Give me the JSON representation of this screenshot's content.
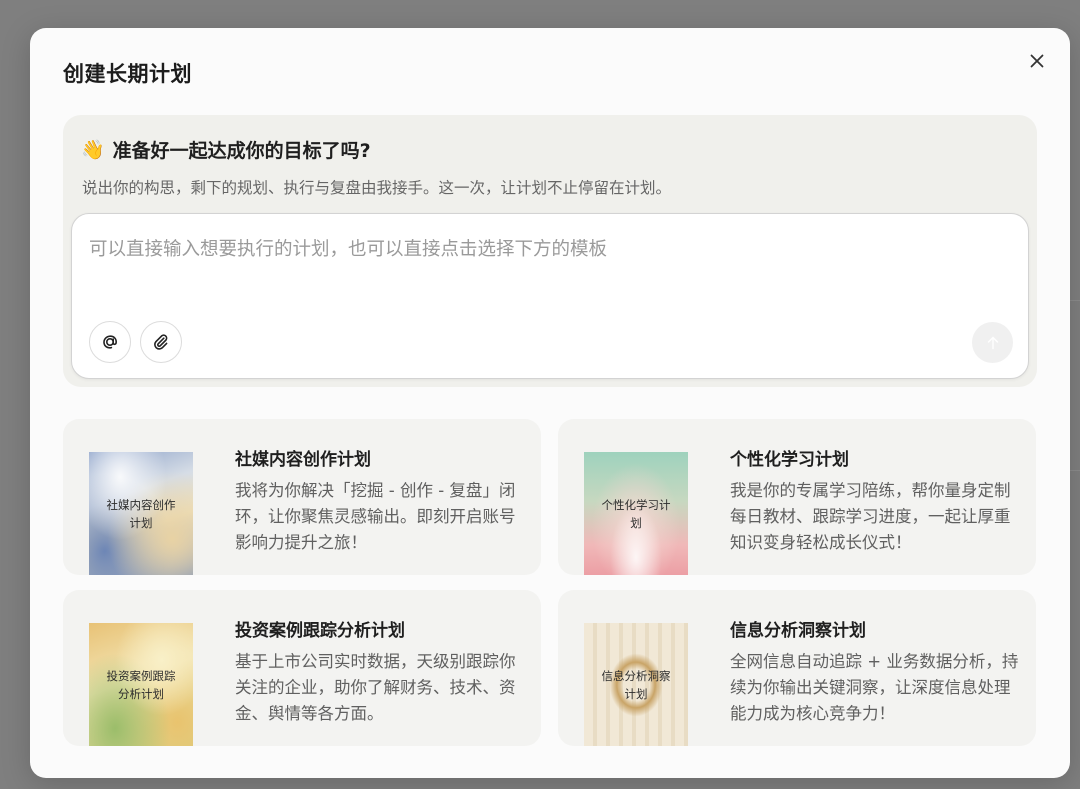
{
  "modal": {
    "title": "创建长期计划",
    "close_icon": "close-icon"
  },
  "hero": {
    "emoji": "👋",
    "title": "准备好一起达成你的目标了吗?",
    "subtitle": "说出你的构思，剩下的规划、执行与复盘由我接手。这一次，让计划不止停留在计划。"
  },
  "input": {
    "placeholder": "可以直接输入想要执行的计划，也可以直接点击选择下方的模板",
    "value": "",
    "mention_icon": "at-icon",
    "attach_icon": "paperclip-icon",
    "send_icon": "arrow-up-icon"
  },
  "templates": [
    {
      "title": "社媒内容创作计划",
      "description": "我将为你解决「挖掘 - 创作 - 复盘」闭环，让你聚焦灵感输出。即刻开启账号影响力提升之旅！",
      "thumb_text": "社媒内容创作计划"
    },
    {
      "title": "个性化学习计划",
      "description": "我是你的专属学习陪练，帮你量身定制每日教材、跟踪学习进度，一起让厚重知识变身轻松成长仪式！",
      "thumb_text": "个性化学习计划"
    },
    {
      "title": "投资案例跟踪分析计划",
      "description": "基于上市公司实时数据，天级别跟踪你关注的企业，助你了解财务、技术、资金、舆情等各方面。",
      "thumb_text": "投资案例跟踪分析计划"
    },
    {
      "title": "信息分析洞察计划",
      "description": "全网信息自动追踪 + 业务数据分析，持续为你输出关键洞察，让深度信息处理能力成为核心竞争力！",
      "thumb_text": "信息分析洞察计划"
    }
  ]
}
